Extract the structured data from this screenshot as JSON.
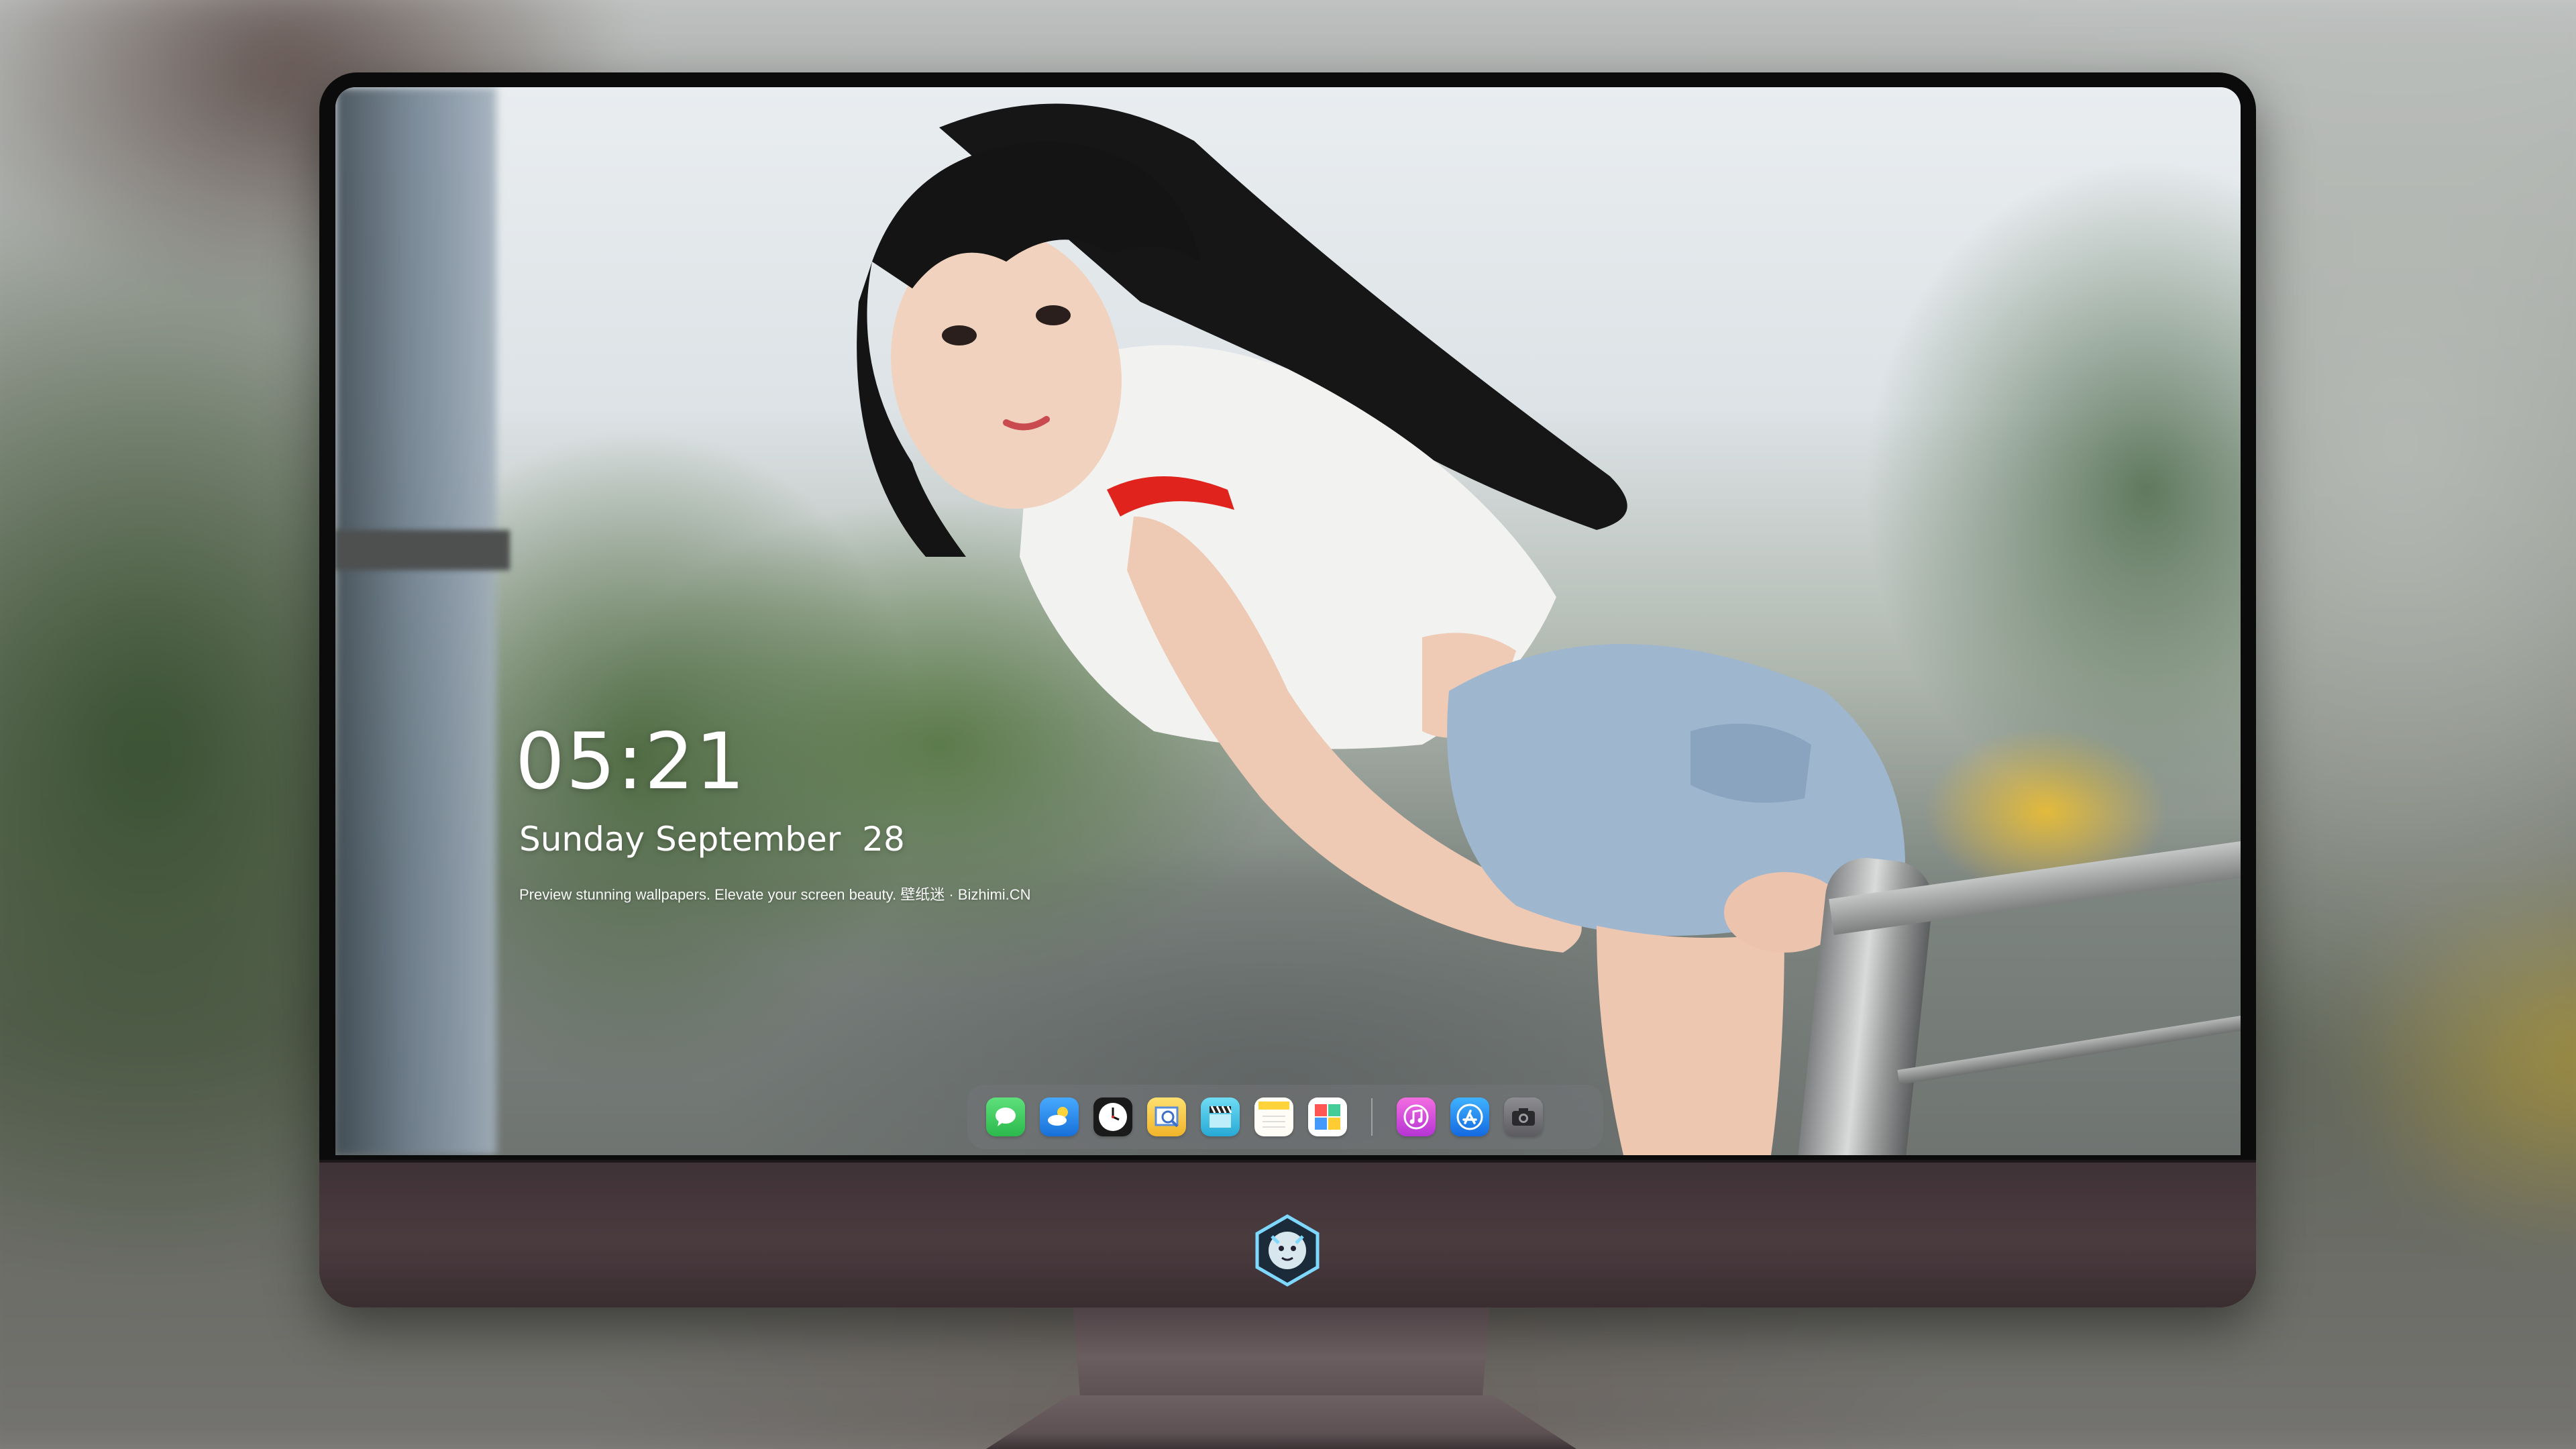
{
  "lock_screen": {
    "time": "05:21",
    "date": "Sunday September  28",
    "tagline": "Preview stunning wallpapers. Elevate your screen beauty. 壁纸迷 · Bizhimi.CN"
  },
  "dock": {
    "apps": [
      {
        "name": "messages-icon",
        "color": "#34c759"
      },
      {
        "name": "weather-icon",
        "color": "#1e8ff5"
      },
      {
        "name": "clock-icon",
        "color": "#111111"
      },
      {
        "name": "preview-icon",
        "color": "#f6c343"
      },
      {
        "name": "clips-icon",
        "color": "#3fc4e6"
      },
      {
        "name": "notes-icon",
        "color": "#ffd43b"
      },
      {
        "name": "photo-booth-icon",
        "color": "#ffffff"
      }
    ],
    "recent_apps": [
      {
        "name": "itunes-icon",
        "color": "#e546d3"
      },
      {
        "name": "app-store-icon",
        "color": "#1a8cf0"
      },
      {
        "name": "camera-icon",
        "color": "#6f6f73"
      }
    ]
  },
  "colors": {
    "chin": "#45373b",
    "bezel": "#0c0b0c",
    "accent_red": "#e0231c"
  }
}
